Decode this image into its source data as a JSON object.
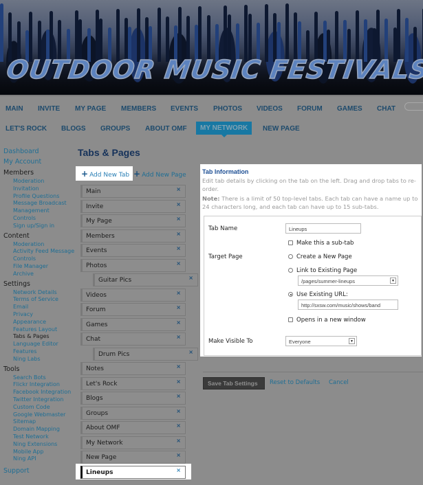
{
  "banner": {
    "logo_text": "OUTDOOR MUSIC FESTIVALS"
  },
  "nav": {
    "row1": [
      "MAIN",
      "INVITE",
      "MY PAGE",
      "MEMBERS",
      "EVENTS",
      "PHOTOS",
      "VIDEOS",
      "FORUM",
      "GAMES",
      "CHAT"
    ],
    "row2": [
      "LET'S ROCK",
      "BLOGS",
      "GROUPS",
      "ABOUT OMF",
      "MY NETWORK",
      "NEW PAGE"
    ],
    "active": "MY NETWORK"
  },
  "sidebar": {
    "dashboard": "Dashboard",
    "my_account": "My Account",
    "sections": [
      {
        "title": "Members",
        "items": [
          "Moderation",
          "Invitation",
          "Profile Questions",
          "Message Broadcast",
          "Management",
          "Controls",
          "Sign up/Sign in"
        ]
      },
      {
        "title": "Content",
        "items": [
          "Moderation",
          "Activity Feed Message",
          "Controls",
          "File Manager",
          "Archive"
        ]
      },
      {
        "title": "Settings",
        "items": [
          "Network Details",
          "Terms of Service",
          "Email",
          "Privacy",
          "Appearance",
          "Features Layout",
          "Tabs & Pages",
          "Language Editor",
          "Features",
          "Ning Labs"
        ]
      },
      {
        "title": "Tools",
        "items": [
          "Search Bots",
          "Flickr Integration",
          "Facebook Integration",
          "Twitter Integration",
          "Custom Code",
          "Google Webmaster",
          "Sitemap",
          "Domain Mapping",
          "Test Network",
          "Ning Extensions",
          "Mobile App",
          "Ning API"
        ]
      }
    ],
    "current": "Tabs & Pages",
    "support": "Support"
  },
  "main": {
    "title": "Tabs & Pages",
    "add_tab": "Add New Tab",
    "add_page": "Add New Page",
    "tabs": [
      {
        "label": "Main",
        "sub": false
      },
      {
        "label": "Invite",
        "sub": false
      },
      {
        "label": "My Page",
        "sub": false
      },
      {
        "label": "Members",
        "sub": false
      },
      {
        "label": "Events",
        "sub": false
      },
      {
        "label": "Photos",
        "sub": false
      },
      {
        "label": "Guitar Pics",
        "sub": true
      },
      {
        "label": "Videos",
        "sub": false
      },
      {
        "label": "Forum",
        "sub": false
      },
      {
        "label": "Games",
        "sub": false
      },
      {
        "label": "Chat",
        "sub": false
      },
      {
        "label": "Drum Pics",
        "sub": true
      },
      {
        "label": "Notes",
        "sub": false
      },
      {
        "label": "Let's Rock",
        "sub": false
      },
      {
        "label": "Blogs",
        "sub": false
      },
      {
        "label": "Groups",
        "sub": false
      },
      {
        "label": "About OMF",
        "sub": false
      },
      {
        "label": "My Network",
        "sub": false
      },
      {
        "label": "New Page",
        "sub": false
      },
      {
        "label": "Lineups",
        "sub": false,
        "selected": true
      }
    ],
    "remove_glyph": "×"
  },
  "panel": {
    "title": "Tab Information",
    "desc": "Edit tab details by clicking on the tab on the left. Drag and drop tabs to re-order.",
    "note_label": "Note:",
    "note": " There is a limit of 50 top-level tabs. Each tab can have a name up to 24 characters long, and each tab can have up to 15 sub-tabs.",
    "tab_name_label": "Tab Name",
    "tab_name_value": "Lineups",
    "subtab_label": "Make this a sub-tab",
    "subtab_checked": false,
    "target_label": "Target Page",
    "opt_new": "Create a New Page",
    "opt_link": "Link to Existing Page",
    "existing_page": "/pages/summer-lineups",
    "opt_url": "Use Existing URL:",
    "url_value": "http://sxsw.com/music/shows/band",
    "target_selected": "Use Existing URL:",
    "new_window_label": "Opens in a new window",
    "new_window_checked": false,
    "visible_label": "Make Visible To",
    "visible_value": "Everyone"
  },
  "actions": {
    "save": "Save Tab Settings",
    "reset": "Reset to Defaults",
    "cancel": "Cancel"
  }
}
